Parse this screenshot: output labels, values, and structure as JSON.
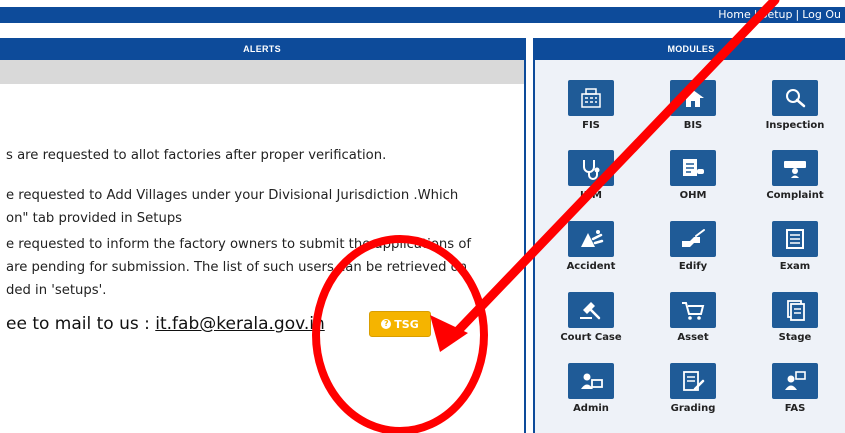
{
  "top_nav": {
    "home": "Home",
    "setup": "Setup",
    "logout": "Log Ou",
    "separator": "|"
  },
  "alerts": {
    "header": "ALERTS",
    "lines": [
      "s are requested to allot factories after proper verification.",
      "e requested to Add Villages under your Divisional Jurisdiction .Which",
      "on\" tab provided in Setups",
      "e requested to inform the factory owners to submit the applications of",
      " are pending for submission. The list of such users can be retrieved on",
      "ded in 'setups'."
    ],
    "mail_prefix": "ee to mail to us : ",
    "mail_link": "it.fab@kerala.gov.in",
    "tsg_label": "TSG",
    "tsg_icon": "question-circle-icon"
  },
  "modules": {
    "header": "MODULES",
    "items": [
      {
        "label": "FIS",
        "icon": "building-icon"
      },
      {
        "label": "BIS",
        "icon": "factory-roof-icon"
      },
      {
        "label": "Inspection",
        "icon": "magnifier-icon"
      },
      {
        "label": "IHM",
        "icon": "stethoscope-icon"
      },
      {
        "label": "OHM",
        "icon": "medical-report-icon"
      },
      {
        "label": "Complaint",
        "icon": "complaint-icon"
      },
      {
        "label": "Accident",
        "icon": "accident-icon"
      },
      {
        "label": "Edify",
        "icon": "edify-hand-icon"
      },
      {
        "label": "Exam",
        "icon": "exam-sheet-icon"
      },
      {
        "label": "Court Case",
        "icon": "gavel-icon"
      },
      {
        "label": "Asset",
        "icon": "cart-icon"
      },
      {
        "label": "Stage",
        "icon": "stacked-pages-icon"
      },
      {
        "label": "Admin",
        "icon": "admin-desk-icon"
      },
      {
        "label": "Grading",
        "icon": "grading-pencil-icon"
      },
      {
        "label": "FAS",
        "icon": "fas-users-icon"
      }
    ]
  },
  "colors": {
    "brand_blue": "#0d4b9a",
    "icon_blue": "#1f5b97",
    "tsg_yellow": "#f5b400",
    "annotation_red": "#ff0000"
  }
}
